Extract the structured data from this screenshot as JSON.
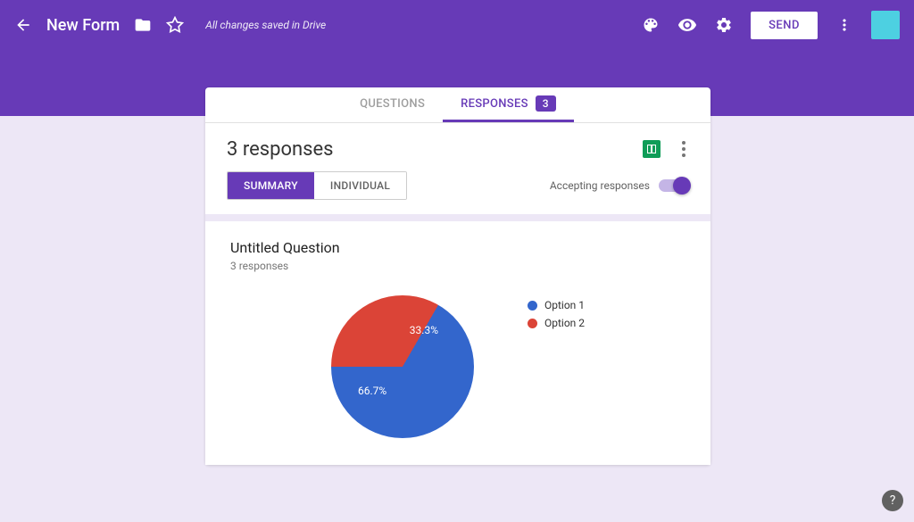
{
  "header": {
    "title": "New Form",
    "saved_text": "All changes saved in Drive",
    "send_label": "SEND"
  },
  "tabs": {
    "questions": "QUESTIONS",
    "responses": "RESPONSES",
    "badge": "3"
  },
  "card": {
    "title": "3 responses",
    "view_summary": "SUMMARY",
    "view_individual": "INDIVIDUAL",
    "accepting_label": "Accepting responses"
  },
  "question": {
    "title": "Untitled Question",
    "sub": "3 responses"
  },
  "chart_data": {
    "type": "pie",
    "series": [
      {
        "name": "Option 1",
        "value": 66.7,
        "label": "66.7%",
        "color": "#3366cc"
      },
      {
        "name": "Option 2",
        "value": 33.3,
        "label": "33.3%",
        "color": "#db4437"
      }
    ]
  },
  "icons": {
    "back": "back-arrow-icon",
    "folder": "folder-icon",
    "star": "star-icon",
    "palette": "palette-icon",
    "eye": "eye-icon",
    "gear": "gear-icon",
    "more": "more-icon",
    "help": "?"
  }
}
